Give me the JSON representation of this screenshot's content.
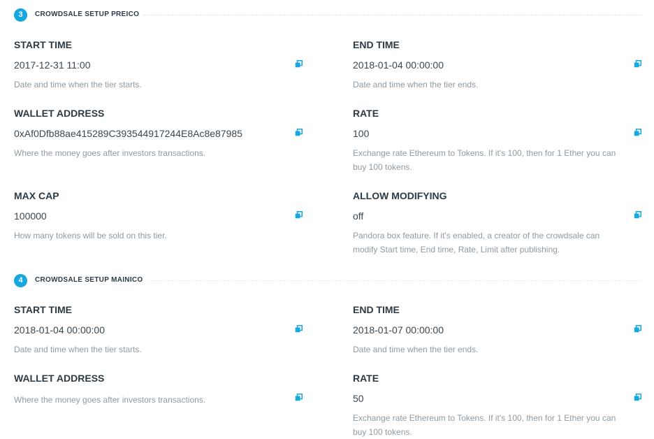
{
  "colors": {
    "accent": "#16a6e0",
    "text": "#2d3a44",
    "muted": "#8e9aa3"
  },
  "sections": [
    {
      "number": "3",
      "title": "CROWDSALE SETUP PREICO",
      "fields": [
        {
          "label": "START TIME",
          "value": "2017-12-31 11:00",
          "description": "Date and time when the tier starts."
        },
        {
          "label": "END TIME",
          "value": "2018-01-04 00:00:00",
          "description": "Date and time when the tier ends."
        },
        {
          "label": "WALLET ADDRESS",
          "value": "0xAf0Dfb88ae415289C393544917244E8Ac8e87985",
          "description": "Where the money goes after investors transactions."
        },
        {
          "label": "RATE",
          "value": "100",
          "description": "Exchange rate Ethereum to Tokens. If it's 100, then for 1 Ether you can buy 100 tokens."
        },
        {
          "label": "MAX CAP",
          "value": "100000",
          "description": "How many tokens will be sold on this tier."
        },
        {
          "label": "ALLOW MODIFYING",
          "value": "off",
          "description": "Pandora box feature. If it's enabled, a creator of the crowdsale can modify Start time, End time, Rate, Limit after publishing."
        }
      ]
    },
    {
      "number": "4",
      "title": "CROWDSALE SETUP MAINICO",
      "fields": [
        {
          "label": "START TIME",
          "value": "2018-01-04 00:00:00",
          "description": "Date and time when the tier starts."
        },
        {
          "label": "END TIME",
          "value": "2018-01-07 00:00:00",
          "description": "Date and time when the tier ends."
        },
        {
          "label": "WALLET ADDRESS",
          "value": "",
          "description": "Where the money goes after investors transactions."
        },
        {
          "label": "RATE",
          "value": "50",
          "description": "Exchange rate Ethereum to Tokens. If it's 100, then for 1 Ether you can buy 100 tokens."
        }
      ]
    }
  ],
  "icons": {
    "copy": "copy-icon"
  }
}
